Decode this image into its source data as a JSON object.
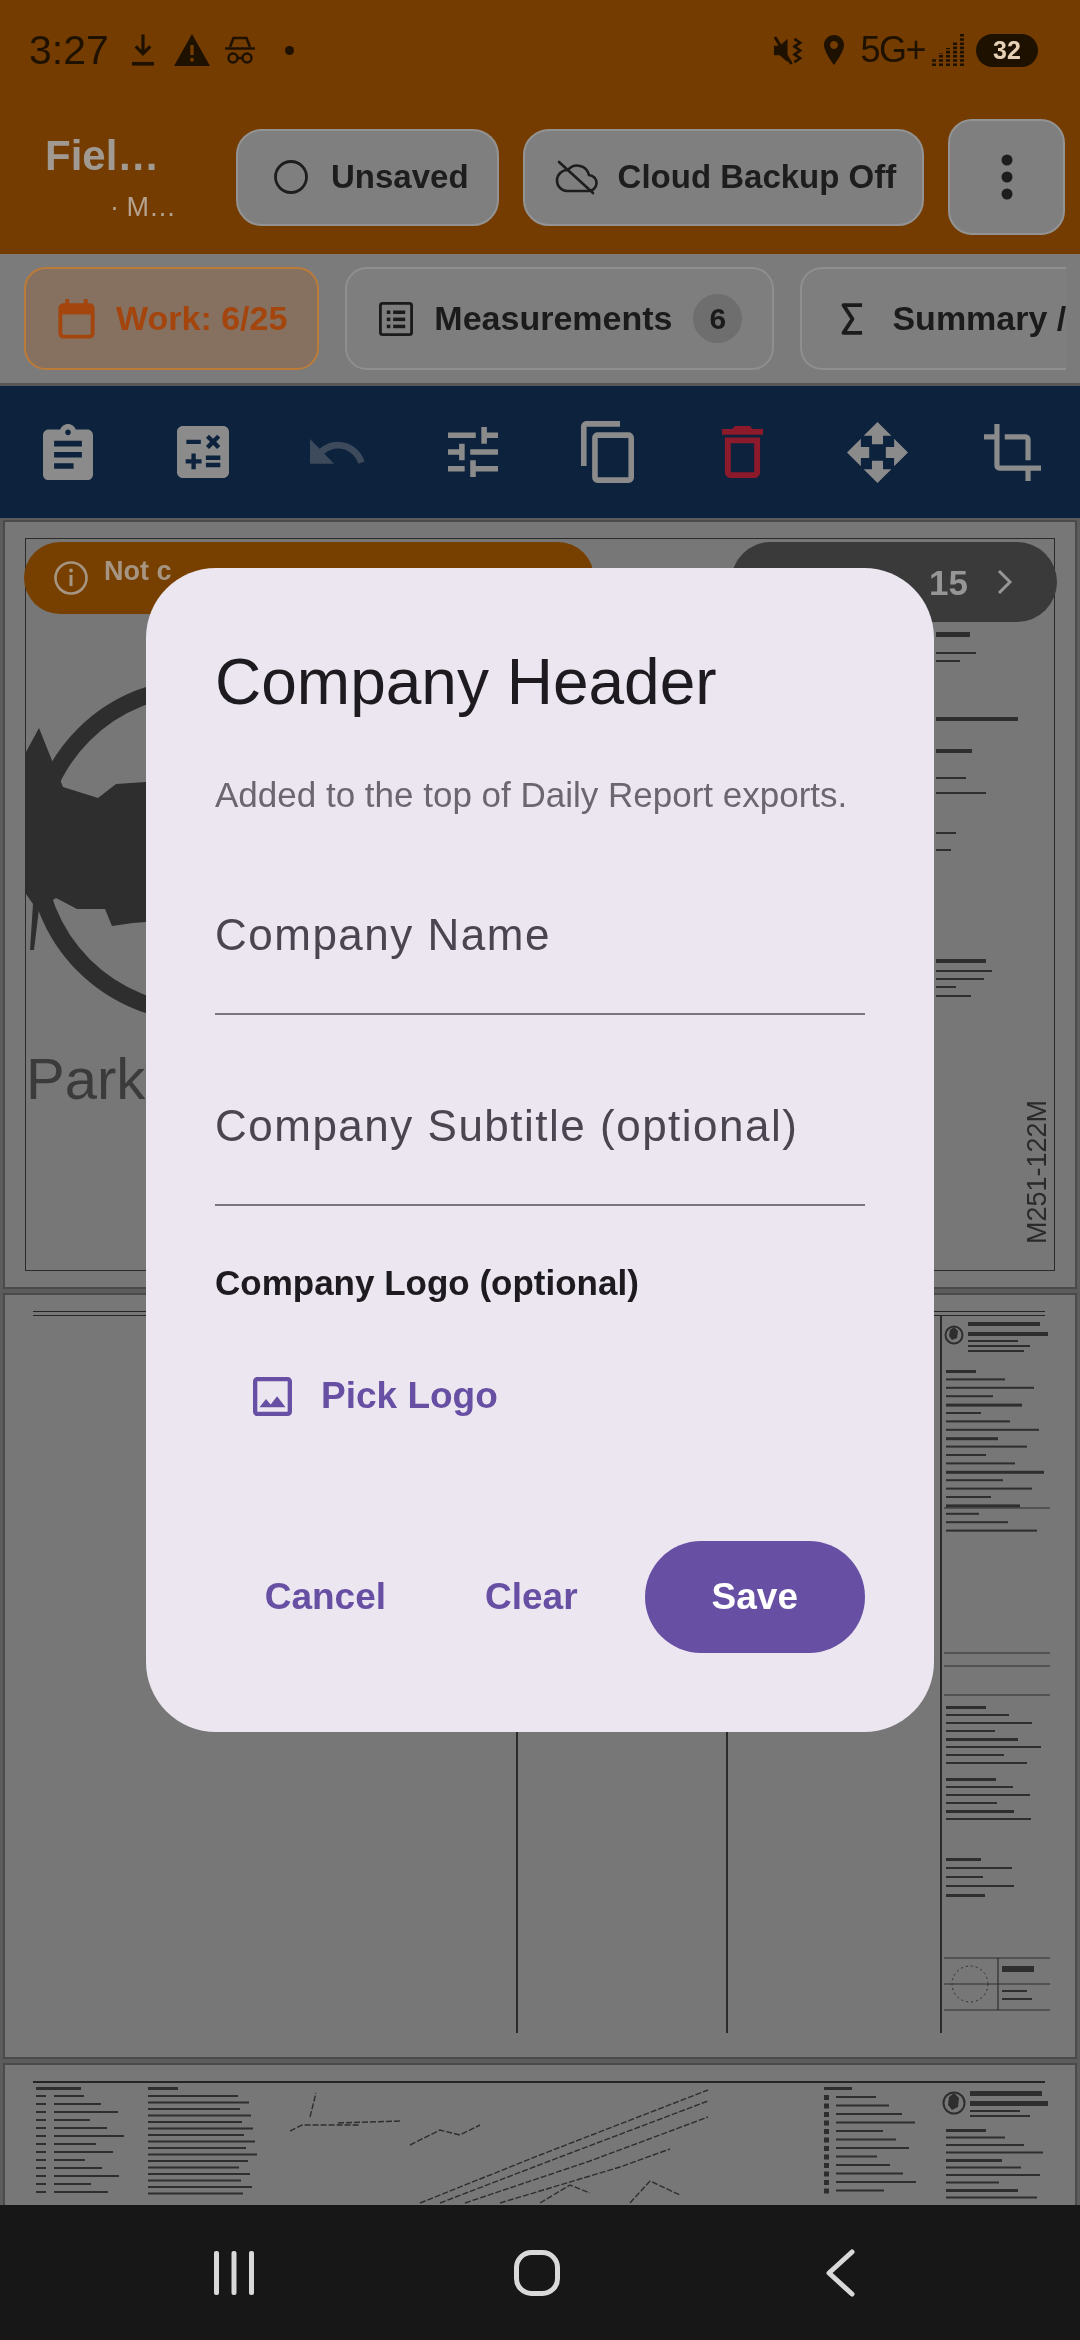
{
  "status_bar": {
    "time": "3:27",
    "network": "5G+",
    "battery": "32"
  },
  "app_bar": {
    "title": "Fiel…",
    "subtitle": "· M…",
    "chips": [
      "Unsaved",
      "Cloud Backup Off"
    ]
  },
  "tabs": [
    {
      "label": "Work: 6/25",
      "selected": true
    },
    {
      "label": "Measurements",
      "badge": "6",
      "selected": false
    },
    {
      "label": "Summary /",
      "selected": false
    }
  ],
  "toolbar": {
    "tools": [
      {
        "disabled": false
      },
      {
        "disabled": false
      },
      {
        "disabled": true
      },
      {
        "disabled": false
      },
      {
        "disabled": false
      },
      {
        "disabled": false
      },
      {
        "disabled": false
      },
      {
        "disabled": false
      }
    ]
  },
  "viewer": {
    "calibration_banner": "Not c",
    "page_indicator": "15",
    "sheet_title": "Park",
    "sheet_number": "M251-122M"
  },
  "dialog": {
    "title": "Company Header",
    "description": "Added to the top of Daily Report exports.",
    "fields": [
      {
        "placeholder": "Company Name"
      },
      {
        "placeholder": "Company Subtitle (optional)"
      }
    ],
    "logo_label": "Company Logo (optional)",
    "pick_logo": "Pick Logo",
    "actions": [
      {
        "kind": "text",
        "label": "Cancel"
      },
      {
        "kind": "text",
        "label": "Clear"
      },
      {
        "kind": "filled",
        "label": "Save"
      }
    ]
  }
}
